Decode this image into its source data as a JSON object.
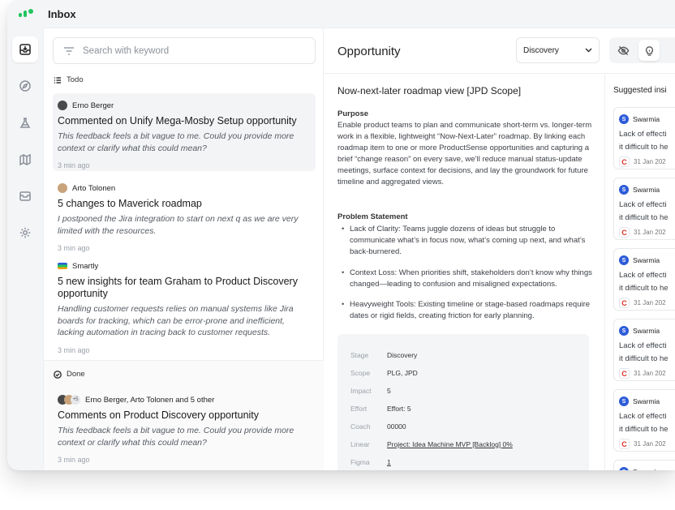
{
  "app": {
    "title": "Inbox"
  },
  "colors": {
    "brand": "#22c55e",
    "swarmia": "#2d5bd8",
    "source_red": "#d93025"
  },
  "rail": {
    "items": [
      {
        "name": "inbox-icon"
      },
      {
        "name": "compass-icon"
      },
      {
        "name": "flask-icon"
      },
      {
        "name": "map-icon"
      },
      {
        "name": "archive-icon"
      },
      {
        "name": "settings-icon"
      }
    ]
  },
  "list": {
    "search_placeholder": "Search with keyword",
    "todo_label": "Todo",
    "done_label": "Done",
    "todo": [
      {
        "author": "Erno Berger",
        "title": "Commented on Unify Mega-Mosby Setup opportunity",
        "body": "This feedback feels a bit vague to me. Could you provide more context or clarify what this could mean?",
        "time": "3 min ago"
      },
      {
        "author": "Arto Tolonen",
        "title": "5 changes to Maverick roadmap",
        "body": "I postponed the Jira integration to start on next q as we are very limited with the resources.",
        "time": "3 min ago"
      },
      {
        "author": "Smartly",
        "title": "5 new insights for team Graham  to Product Discovery opportunity",
        "body": "Handling customer requests relies on manual systems like Jira boards for tracking, which can be error-prone and inefficient, lacking automation in tracing back to customer requests.",
        "time": "3 min ago"
      }
    ],
    "done": [
      {
        "author": "Erno Berger, Arto Tolonen and 5 other",
        "extra_count": "+5",
        "title": "Comments on Product Discovery opportunity",
        "body": "This feedback feels a bit vague to me. Could you provide more context or clarify what this could mean?",
        "time": "3 min ago"
      }
    ]
  },
  "detail": {
    "header_title": "Opportunity",
    "stage_select": "Discovery",
    "doc_title": "Now-next-later roadmap view [JPD Scope]",
    "purpose_heading": "Purpose",
    "purpose_text": "Enable product teams to plan and communicate short-term vs. longer-term work in a flexible, lightweight “Now-Next-Later” roadmap. By linking each roadmap item to one or more ProductSense opportunities and capturing a brief “change reason” on every save, we’ll reduce manual status-update meetings, surface context for decisions, and lay the groundwork for future timeline and aggregated views.",
    "problem_heading": "Problem Statement",
    "problems": [
      "Lack of Clarity: Teams juggle dozens of ideas but struggle to communicate what’s in focus now, what’s coming up next, and what’s back-burnered.",
      "Context Loss: When priorities shift, stakeholders don’t know why things changed—leading to confusion and misaligned expectations.",
      "Heavyweight Tools: Existing timeline or stage-based roadmaps require dates or rigid fields, creating friction for early planning."
    ],
    "properties": [
      {
        "label": "Stage",
        "value": "Discovery"
      },
      {
        "label": "Scope",
        "value": "PLG, JPD"
      },
      {
        "label": "Impact",
        "value": "5"
      },
      {
        "label": "Effort",
        "value": "Effort: 5"
      },
      {
        "label": "Coach",
        "value": "00000"
      },
      {
        "label": "Linear",
        "value": "Project: Idea Machine MVP [Backlog] 0%"
      },
      {
        "label": "Figma",
        "value": "1"
      }
    ]
  },
  "insights": {
    "title": "Suggested insi",
    "items": [
      {
        "source": "Swarmia",
        "line1": "Lack of effecti",
        "line2": "it difficult to he",
        "date": "31 Jan 202"
      },
      {
        "source": "Swarmia",
        "line1": "Lack of effecti",
        "line2": "it difficult to he",
        "date": "31 Jan 202"
      },
      {
        "source": "Swarmia",
        "line1": "Lack of effecti",
        "line2": "it difficult to he",
        "date": "31 Jan 202"
      },
      {
        "source": "Swarmia",
        "line1": "Lack of effecti",
        "line2": "it difficult to he",
        "date": "31 Jan 202"
      },
      {
        "source": "Swarmia",
        "line1": "Lack of effecti",
        "line2": "it difficult to he",
        "date": "31 Jan 202"
      },
      {
        "source": "Swarmia",
        "line1": "",
        "line2": "",
        "date": ""
      }
    ]
  }
}
